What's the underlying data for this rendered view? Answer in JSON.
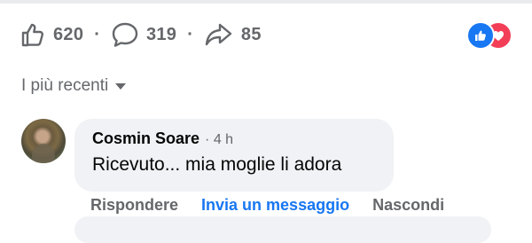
{
  "stats": {
    "likes": "620",
    "comments": "319",
    "shares": "85",
    "separator": "·"
  },
  "reactions": {
    "types": [
      "like",
      "love"
    ],
    "colors": {
      "like": "#1877f2",
      "love": "#f33e58"
    }
  },
  "sort": {
    "label": "I più recenti"
  },
  "comment": {
    "author": "Cosmin Soare",
    "time": "· 4 h",
    "text": "Ricevuto... mia moglie li adora",
    "actions": {
      "reply": "Rispondere",
      "message": "Invia un messaggio",
      "hide": "Nascondi"
    }
  },
  "colors": {
    "accent": "#1877f2",
    "bubble": "#f0f2f5",
    "secondary_text": "#65676b"
  }
}
